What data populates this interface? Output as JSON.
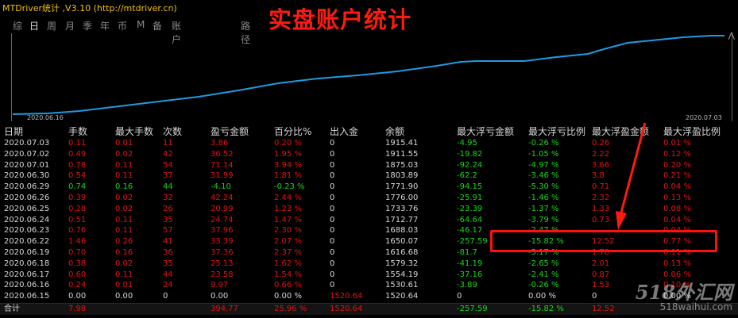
{
  "app": {
    "title": "MTDriver统计 ,V3.10 (http://mtdriver.cn)",
    "overlay_title": "实盘账户统计"
  },
  "tabs": [
    {
      "label": "综",
      "active": false
    },
    {
      "label": "日",
      "active": true
    },
    {
      "label": "周",
      "active": false
    },
    {
      "label": "月",
      "active": false
    },
    {
      "label": "季",
      "active": false
    },
    {
      "label": "年",
      "active": false
    },
    {
      "label": "币",
      "active": false
    },
    {
      "label": "M",
      "active": false
    },
    {
      "label": "备",
      "active": false
    },
    {
      "label": "账户",
      "active": false
    },
    {
      "label": "路径",
      "active": false
    }
  ],
  "chart": {
    "start_date": "2020.06.16",
    "end_date": "2020.07.03",
    "grip": "⋀",
    "line_color": "#1e9be0"
  },
  "table": {
    "headers": [
      "日期",
      "手数",
      "最大手数",
      "次数",
      "盈亏金额",
      "百分比%",
      "出入金",
      "余额",
      "最大浮亏金额",
      "最大浮亏比例",
      "最大浮盈金额",
      "最大浮盈比例"
    ],
    "rows": [
      [
        "2020.07.03",
        "0.11",
        "0.01",
        "11",
        "3.86",
        "0.20 %",
        "0",
        "1915.41",
        "-4.95",
        "-0.26 %",
        "0.26",
        "0.01 %"
      ],
      [
        "2020.07.02",
        "0.49",
        "0.02",
        "42",
        "36.52",
        "1.95 %",
        "0",
        "1911.55",
        "-19.82",
        "-1.05 %",
        "2.22",
        "0.12 %"
      ],
      [
        "2020.07.01",
        "0.78",
        "0.11",
        "54",
        "71.14",
        "3.94 %",
        "0",
        "1875.03",
        "-92.24",
        "-4.97 %",
        "3.66",
        "0.20 %"
      ],
      [
        "2020.06.30",
        "0.54",
        "0.11",
        "37",
        "31.99",
        "1.81 %",
        "0",
        "1803.89",
        "-62.2",
        "-3.46 %",
        "3.8",
        "0.21 %"
      ],
      [
        "2020.06.29",
        "0.74",
        "0.16",
        "44",
        "-4.10",
        "-0.23 %",
        "0",
        "1771.90",
        "-94.15",
        "-5.30 %",
        "0.71",
        "0.04 %"
      ],
      [
        "2020.06.26",
        "0.39",
        "0.02",
        "32",
        "42.24",
        "2.44 %",
        "0",
        "1776.00",
        "-25.91",
        "-1.46 %",
        "2.32",
        "0.13 %"
      ],
      [
        "2020.06.25",
        "0.28",
        "0.02",
        "26",
        "20.99",
        "1.23 %",
        "0",
        "1733.76",
        "-23.39",
        "-1.37 %",
        "1.33",
        "0.08 %"
      ],
      [
        "2020.06.24",
        "0.51",
        "0.11",
        "35",
        "24.74",
        "1.47 %",
        "0",
        "1712.77",
        "-64.64",
        "-3.79 %",
        "0.73",
        "0.04 %"
      ],
      [
        "2020.06.23",
        "0.76",
        "0.11",
        "57",
        "37.96",
        "2.30 %",
        "0",
        "1688.03",
        "-46.17",
        "-2.47 %",
        "",
        "0.04 %"
      ],
      [
        "2020.06.22",
        "1.46",
        "0.26",
        "41",
        "33.39",
        "2.07 %",
        "0",
        "1650.07",
        "-257.59",
        "-15.82 %",
        "12.52",
        "0.77 %"
      ],
      [
        "2020.06.19",
        "0.70",
        "0.16",
        "36",
        "37.36",
        "2.37 %",
        "0",
        "1616.68",
        "-81.7",
        "-5.17 %",
        "1.78",
        "0.11 %"
      ],
      [
        "2020.06.18",
        "0.38",
        "0.02",
        "35",
        "25.13",
        "1.62 %",
        "0",
        "1579.32",
        "-41.19",
        "-2.65 %",
        "2.01",
        "0.13 %"
      ],
      [
        "2020.06.17",
        "0.60",
        "0.11",
        "44",
        "23.58",
        "1.54 %",
        "0",
        "1554.19",
        "-37.16",
        "-2.41 %",
        "0.87",
        "0.06 %"
      ],
      [
        "2020.06.16",
        "0.24",
        "0.01",
        "24",
        "9.97",
        "0.66 %",
        "0",
        "1530.61",
        "-3.89",
        "-0.26 %",
        "1.53",
        "0.10 %"
      ],
      [
        "2020.06.15",
        "0.00",
        "0.00",
        "0",
        "0.00",
        "0.00 %",
        "1520.64",
        "1520.64",
        "0",
        "0.00 %",
        "0",
        "0.00 %"
      ]
    ],
    "total": [
      "合计",
      "7.98",
      "",
      "394.77",
      "25.96 %",
      "1520.64",
      "",
      "-257.59",
      "-15.82 %",
      "12.52",
      ""
    ]
  },
  "watermark": {
    "brand": "518外汇网",
    "url": "518waihui.com"
  },
  "colors": {
    "positive": "#e21212",
    "negative": "#18d818",
    "neutral": "#d8d8d8",
    "highlight": "#ff1010"
  }
}
